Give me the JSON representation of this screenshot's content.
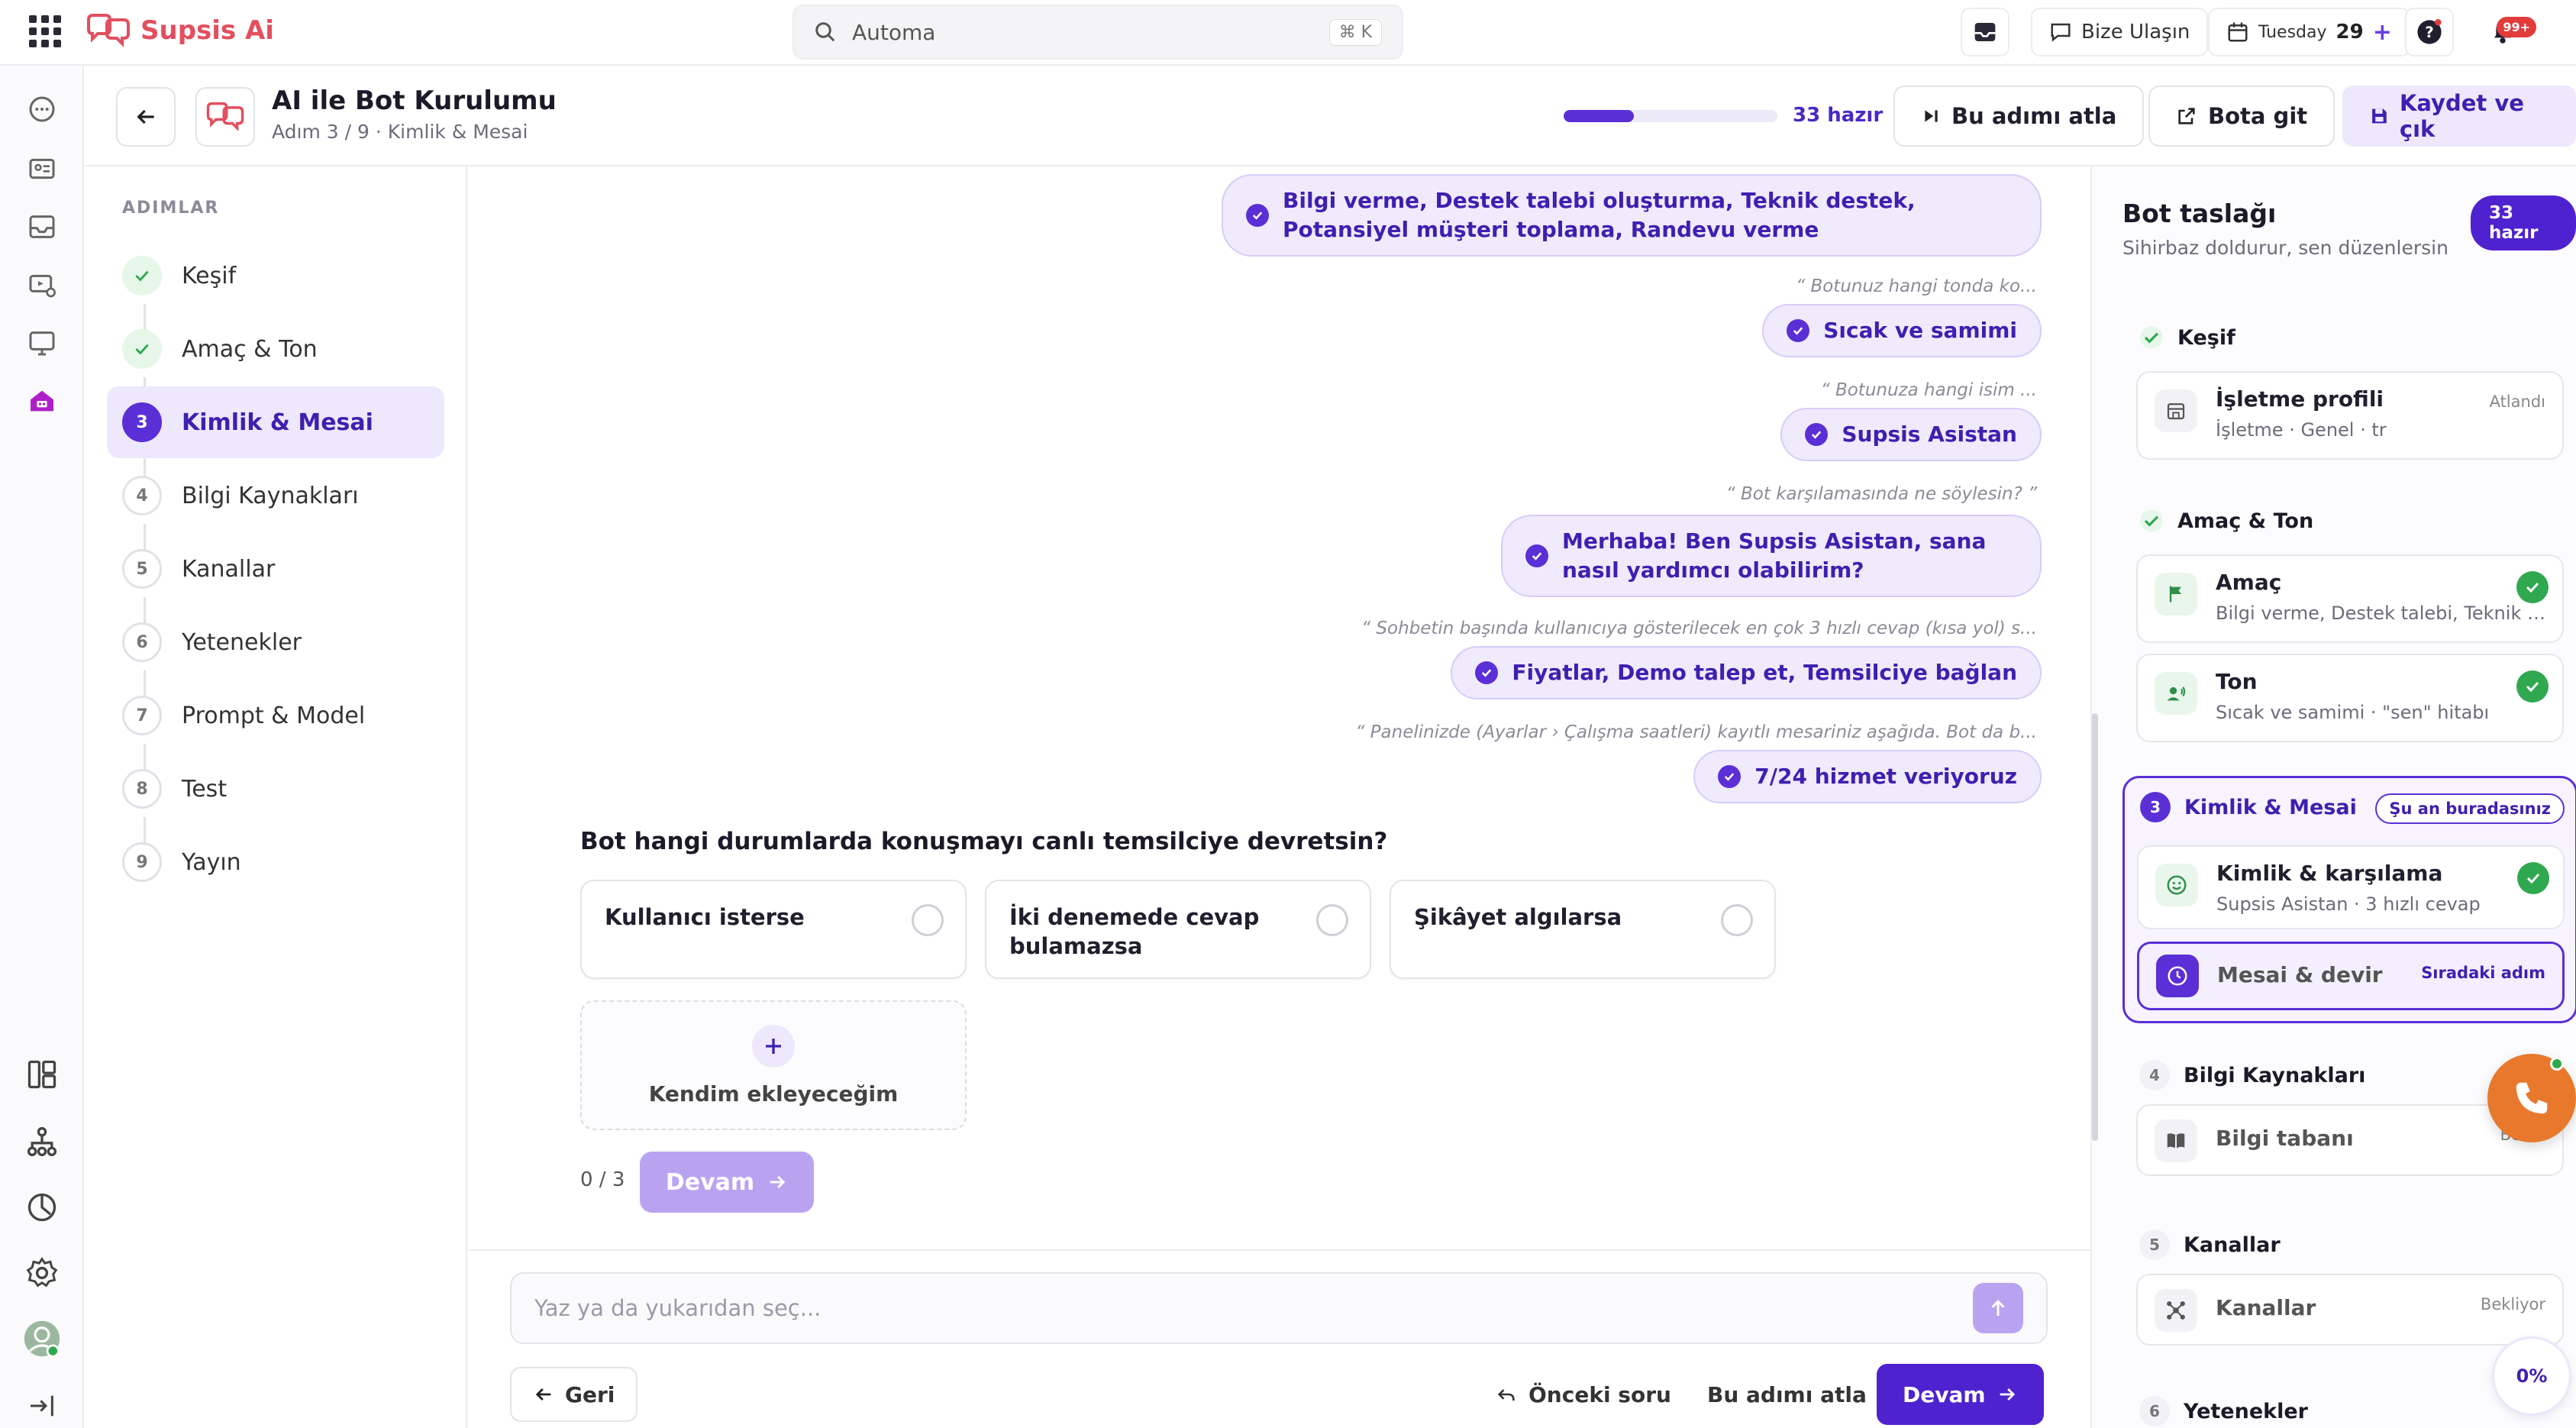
{
  "app": {
    "brand": "Supsis Ai"
  },
  "topbar": {
    "search_placeholder": "Automa",
    "search_shortcut": "⌘ K",
    "contact_label": "Bize Ulaşın",
    "date_day": "Tuesday",
    "date_num": "29",
    "notif_badge": "99+"
  },
  "header": {
    "title": "AI ile Bot Kurulumu",
    "subtitle": "Adım 3 / 9 · Kimlik & Mesai",
    "progress_fraction": 0.33,
    "progress_label": "33 hazır",
    "skip_label": "Bu adımı atla",
    "gotobot_label": "Bota git",
    "save_label": "Kaydet ve çık"
  },
  "steps": {
    "title": "ADIMLAR",
    "items": [
      {
        "num": "1",
        "label": "Keşif",
        "state": "done"
      },
      {
        "num": "2",
        "label": "Amaç & Ton",
        "state": "done"
      },
      {
        "num": "3",
        "label": "Kimlik & Mesai",
        "state": "current"
      },
      {
        "num": "4",
        "label": "Bilgi Kaynakları",
        "state": "todo"
      },
      {
        "num": "5",
        "label": "Kanallar",
        "state": "todo"
      },
      {
        "num": "6",
        "label": "Yetenekler",
        "state": "todo"
      },
      {
        "num": "7",
        "label": "Prompt & Model",
        "state": "todo"
      },
      {
        "num": "8",
        "label": "Test",
        "state": "todo"
      },
      {
        "num": "9",
        "label": "Yayın",
        "state": "todo"
      }
    ]
  },
  "chat": {
    "answers": [
      {
        "question": "",
        "answer": "Bilgi verme, Destek talebi oluşturma, Teknik destek, Potansiyel müşteri toplama, Randevu verme"
      },
      {
        "question": "“ Botunuz hangi tonda ko...",
        "answer": "Sıcak ve samimi"
      },
      {
        "question": "“ Botunuza hangi isim ...",
        "answer": "Supsis Asistan"
      },
      {
        "question": "“ Bot karşılamasında ne söylesin? ”",
        "answer": "Merhaba! Ben Supsis Asistan, sana nasıl yardımcı olabilirim?"
      },
      {
        "question": "“ Sohbetin başında kullanıcıya gösterilecek en çok 3 hızlı cevap (kısa yol) s...",
        "answer": "Fiyatlar, Demo talep et, Temsilciye bağlan"
      },
      {
        "question": "“ Panelinizde (Ayarlar › Çalışma saatleri) kayıtlı mesariniz aşağıda. Bot da b...",
        "answer": "7/24 hizmet veriyoruz"
      }
    ],
    "question": "Bot hangi durumlarda konuşmayı canlı temsilciye devretsin?",
    "options": [
      {
        "label": "Kullanıcı isterse"
      },
      {
        "label": "İki denemede cevap bulamazsa"
      },
      {
        "label": "Şikâyet algılarsa"
      }
    ],
    "add_option_label": "Kendim ekleyeceğim",
    "counter": "0 / 3",
    "continue_label": "Devam"
  },
  "composer": {
    "placeholder": "Yaz ya da yukarıdan seç...",
    "back_label": "Geri",
    "prev_label": "Önceki soru",
    "skip_label": "Bu adımı atla",
    "continue_label": "Devam"
  },
  "draft": {
    "title": "Bot taslağı",
    "subtitle": "Sihirbaz doldurur, sen düzenlersin",
    "pill": "33 hazır",
    "sections": {
      "kesif": {
        "title": "Keşif",
        "card_title": "İşletme profili",
        "card_sub": "İşletme · Genel · tr",
        "card_tag": "Atlandı"
      },
      "amac": {
        "title": "Amaç & Ton",
        "cards": [
          {
            "title": "Amaç",
            "sub": "Bilgi verme, Destek talebi, Teknik de..."
          },
          {
            "title": "Ton",
            "sub": "Sıcak ve samimi · \"sen\" hitabı"
          }
        ]
      },
      "kimlik": {
        "num": "3",
        "title": "Kimlik & Mesai",
        "here": "Şu an buradasınız",
        "cards": [
          {
            "title": "Kimlik & karşılama",
            "sub": "Supsis Asistan · 3 hızlı cevap"
          },
          {
            "title": "Mesai & devir",
            "tag": "Sıradaki adım"
          }
        ]
      },
      "bilgi": {
        "num": "4",
        "title": "Bilgi Kaynakları",
        "card_title": "Bilgi tabanı",
        "card_tag": "Bek..."
      },
      "kanallar": {
        "num": "5",
        "title": "Kanallar",
        "card_title": "Kanallar",
        "card_tag": "Bekliyor"
      },
      "yetenekler": {
        "num": "6",
        "title": "Yetenekler"
      }
    },
    "completion": "0%"
  },
  "colors": {
    "accent": "#5b2fd6",
    "brand": "#e24f5e",
    "success": "#2fa84f",
    "call": "#e8792c"
  }
}
